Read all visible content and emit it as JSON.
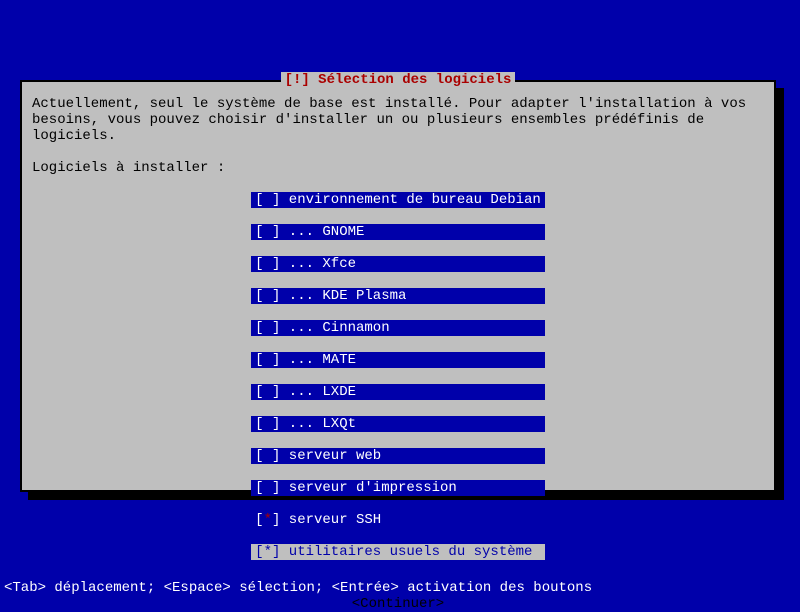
{
  "dialog": {
    "title": "[!] Sélection des logiciels",
    "description": "Actuellement, seul le système de base est installé. Pour adapter l'installation à vos\nbesoins, vous pouvez choisir d'installer un ou plusieurs ensembles prédéfinis de\nlogiciels.",
    "prompt": "Logiciels à installer :",
    "items": [
      {
        "label": "environnement de bureau Debian",
        "checked": false,
        "indent": false,
        "focused": false
      },
      {
        "label": "GNOME",
        "checked": false,
        "indent": true,
        "focused": false
      },
      {
        "label": "Xfce",
        "checked": false,
        "indent": true,
        "focused": false
      },
      {
        "label": "KDE Plasma",
        "checked": false,
        "indent": true,
        "focused": false
      },
      {
        "label": "Cinnamon",
        "checked": false,
        "indent": true,
        "focused": false
      },
      {
        "label": "MATE",
        "checked": false,
        "indent": true,
        "focused": false
      },
      {
        "label": "LXDE",
        "checked": false,
        "indent": true,
        "focused": false
      },
      {
        "label": "LXQt",
        "checked": false,
        "indent": true,
        "focused": false
      },
      {
        "label": "serveur web",
        "checked": false,
        "indent": false,
        "focused": false
      },
      {
        "label": "serveur d'impression",
        "checked": false,
        "indent": false,
        "focused": false
      },
      {
        "label": "serveur SSH",
        "checked": true,
        "indent": false,
        "focused": true
      },
      {
        "label": "utilitaires usuels du système",
        "checked": true,
        "indent": false,
        "focused": false,
        "lastrow": true
      }
    ],
    "continue": "<Continuer>"
  },
  "footer": "<Tab> déplacement; <Espace> sélection; <Entrée> activation des boutons"
}
